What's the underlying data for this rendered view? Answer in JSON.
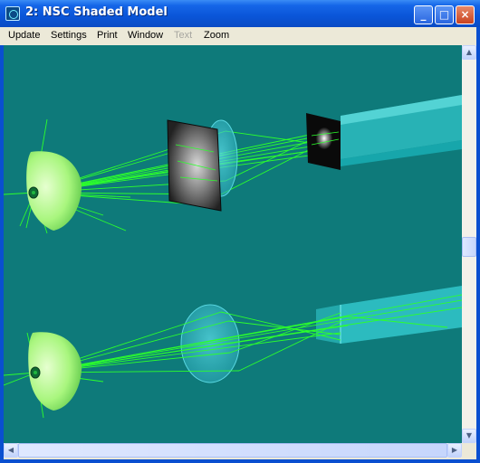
{
  "window": {
    "title": "2: NSC Shaded Model"
  },
  "title_buttons": {
    "minimize": "_",
    "maximize": "□",
    "close": "×"
  },
  "menu": [
    {
      "label": "Update",
      "enabled": true
    },
    {
      "label": "Settings",
      "enabled": true
    },
    {
      "label": "Print",
      "enabled": true
    },
    {
      "label": "Window",
      "enabled": true
    },
    {
      "label": "Text",
      "enabled": false
    },
    {
      "label": "Zoom",
      "enabled": true
    }
  ],
  "scrollbars": {
    "up": "▲",
    "down": "▼",
    "left": "◀",
    "right": "▶"
  },
  "colors": {
    "background": "#0e7a7a",
    "rays": "#2cff2c",
    "source": "#b8ff9a",
    "lens": "#39c9d6",
    "beam": "#3ee0e6",
    "title_bar": "#0a55d8"
  },
  "scene": {
    "layout": "two ray-trace models stacked vertically",
    "icons": [
      "light-source-icon",
      "lens-icon",
      "detector-icon",
      "beam-icon"
    ]
  }
}
